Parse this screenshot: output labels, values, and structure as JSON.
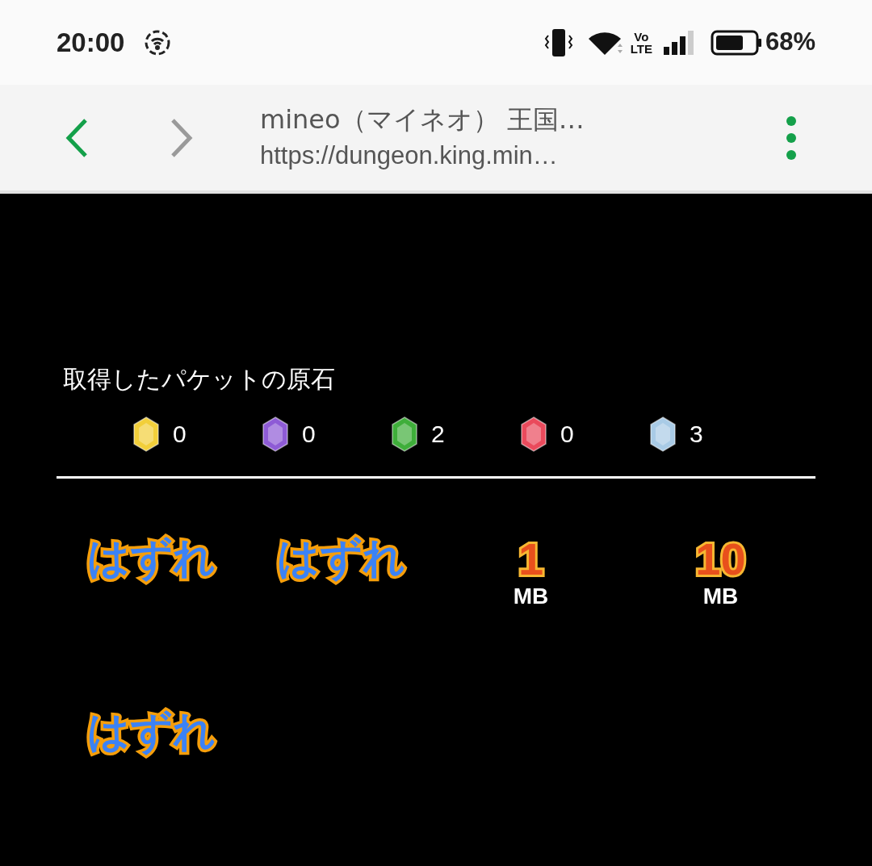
{
  "status_bar": {
    "time": "20:00",
    "network_label": [
      "Vo",
      "LTE"
    ],
    "battery": "68%"
  },
  "browser_toolbar": {
    "title": "mineo（マイネオ） 王国…",
    "url": "https://dungeon.king.min…"
  },
  "gems_section": {
    "heading": "取得したパケットの原石",
    "gems": [
      {
        "color": "#f2cf3a",
        "count": "0"
      },
      {
        "color": "#8e5bd6",
        "count": "0"
      },
      {
        "color": "#3fae3a",
        "count": "2"
      },
      {
        "color": "#ea4a5c",
        "count": "0"
      },
      {
        "color": "#a9cbe6",
        "count": "3"
      }
    ]
  },
  "prizes": [
    {
      "kind": "miss",
      "label": "はずれ"
    },
    {
      "kind": "miss",
      "label": "はずれ"
    },
    {
      "kind": "packet",
      "amount": "1",
      "unit": "MB"
    },
    {
      "kind": "packet",
      "amount": "10",
      "unit": "MB"
    },
    {
      "kind": "miss",
      "label": "はずれ"
    }
  ]
}
